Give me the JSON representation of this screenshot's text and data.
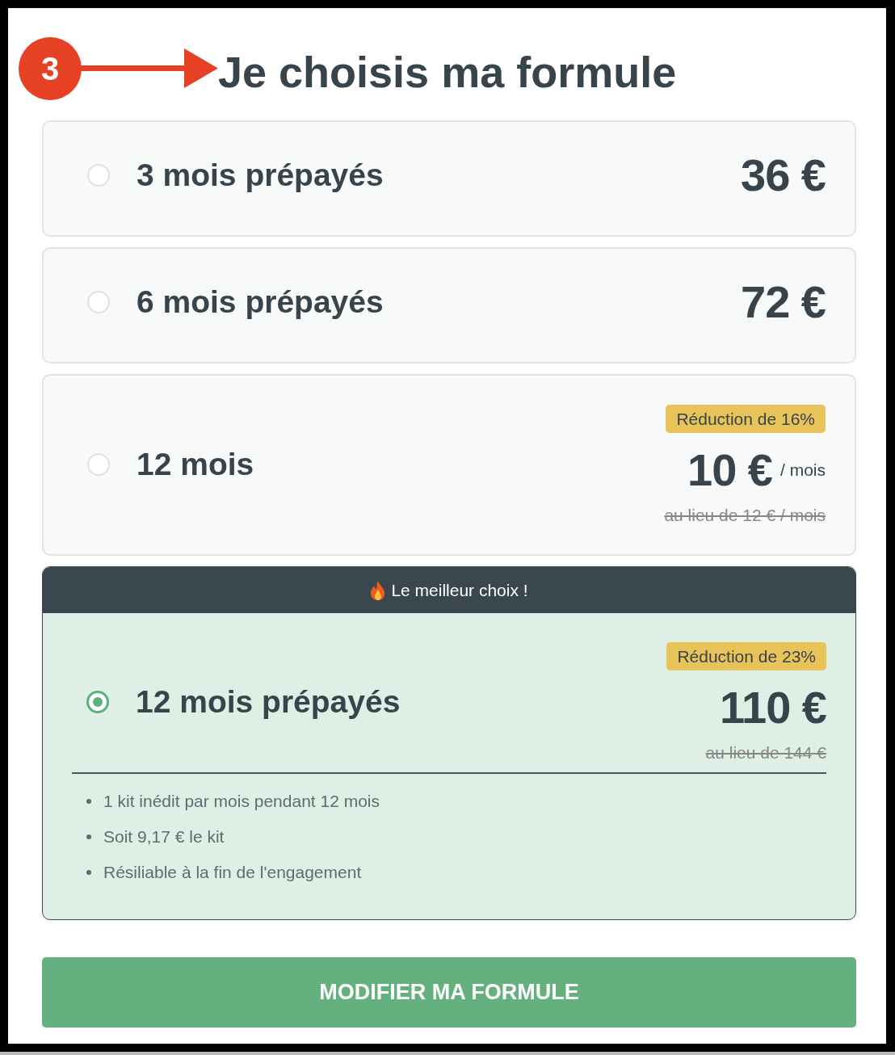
{
  "step_marker": {
    "number": "3"
  },
  "title": "Je choisis ma formule",
  "plans": [
    {
      "label": "3 mois prépayés",
      "price": "36 €",
      "selected": false
    },
    {
      "label": "6 mois prépayés",
      "price": "72 €",
      "selected": false
    },
    {
      "label": "12 mois",
      "badge": "Réduction de 16%",
      "price": "10 €",
      "price_unit": "/ mois",
      "old_price": "au lieu de 12 € / mois",
      "selected": false
    },
    {
      "ribbon": "Le meilleur choix !",
      "label": "12 mois prépayés",
      "badge": "Réduction de 23%",
      "price": "110 €",
      "old_price": "au lieu de 144 €",
      "features": [
        "1 kit inédit par mois pendant 12 mois",
        "Soit 9,17 € le kit",
        "Résiliable à la fin de l'engagement"
      ],
      "selected": true
    }
  ],
  "submit_button": "MODIFIER MA FORMULE"
}
